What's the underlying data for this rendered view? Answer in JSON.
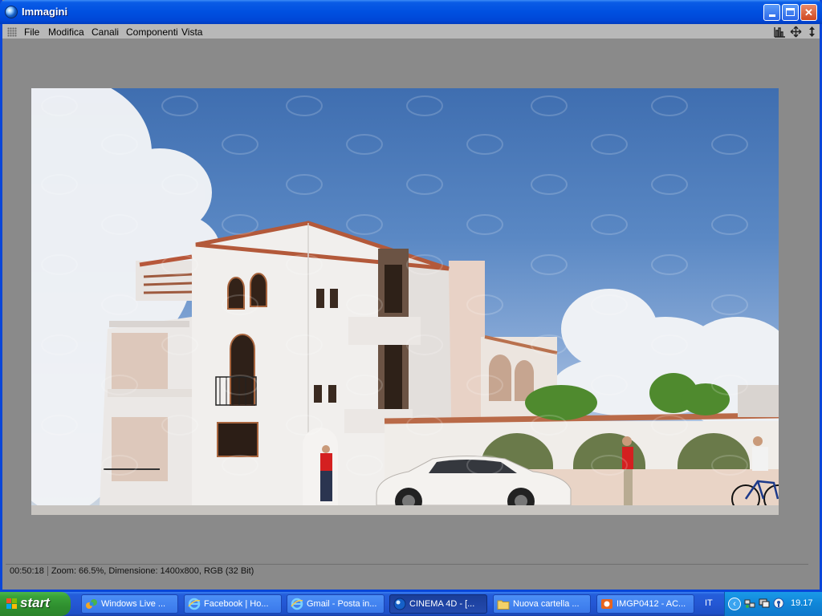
{
  "window": {
    "title": "Immagini",
    "menu": [
      "File",
      "Modifica",
      "Canali",
      "Componenti",
      "Vista"
    ]
  },
  "status": {
    "time": "00:50:18",
    "info": "Zoom: 66.5%, Dimensione: 1400x800, RGB (32 Bit)"
  },
  "taskbar": {
    "start_label": "start",
    "tasks": [
      {
        "label": "Windows Live ...",
        "icon": "windows-live-icon"
      },
      {
        "label": "Facebook | Ho...",
        "icon": "internet-explorer-icon"
      },
      {
        "label": "Gmail - Posta in...",
        "icon": "internet-explorer-icon"
      },
      {
        "label": "CINEMA 4D - [...",
        "icon": "cinema4d-icon"
      },
      {
        "label": "Nuova cartella ...",
        "icon": "folder-icon"
      },
      {
        "label": "IMGP0412 - AC...",
        "icon": "acdsee-icon"
      }
    ],
    "language": "IT",
    "clock": "19.17"
  },
  "colors": {
    "titlebar": "#0050e0",
    "taskbar": "#245edb",
    "start": "#39a239",
    "tray": "#1086d8"
  }
}
